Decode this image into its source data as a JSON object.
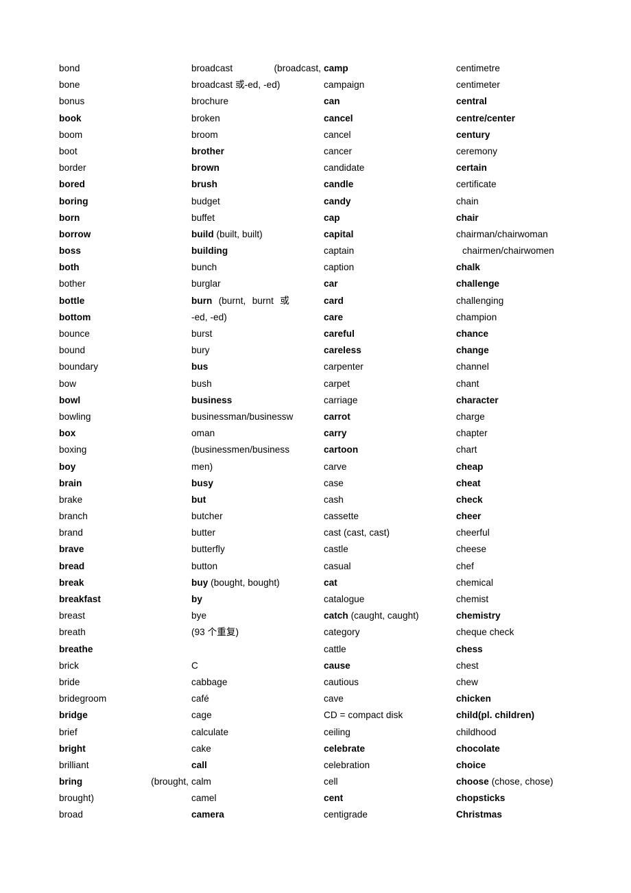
{
  "document": {
    "type": "vocabulary-word-list",
    "page_background": "#ffffff",
    "text_color": "#000000",
    "column_count": 4,
    "note_bold_meaning": "bold entries are required/core vocabulary words"
  },
  "columns": [
    {
      "name": "column-1",
      "entries": [
        {
          "text": "bond",
          "bold": false
        },
        {
          "text": "bone",
          "bold": false
        },
        {
          "text": "bonus",
          "bold": false
        },
        {
          "text": "book",
          "bold": true
        },
        {
          "text": "boom",
          "bold": false
        },
        {
          "text": "boot",
          "bold": false
        },
        {
          "text": "border",
          "bold": false
        },
        {
          "text": "bored",
          "bold": true
        },
        {
          "text": "boring",
          "bold": true
        },
        {
          "text": "born",
          "bold": true
        },
        {
          "text": "borrow",
          "bold": true
        },
        {
          "text": "boss",
          "bold": true
        },
        {
          "text": "both",
          "bold": true
        },
        {
          "text": "bother",
          "bold": false
        },
        {
          "text": "bottle",
          "bold": true
        },
        {
          "text": "bottom",
          "bold": true
        },
        {
          "text": "bounce",
          "bold": false
        },
        {
          "text": "bound",
          "bold": false
        },
        {
          "text": "boundary",
          "bold": false
        },
        {
          "text": "bow",
          "bold": false
        },
        {
          "text": "bowl",
          "bold": true
        },
        {
          "text": "bowling",
          "bold": false
        },
        {
          "text": "box",
          "bold": true
        },
        {
          "text": "boxing",
          "bold": false
        },
        {
          "text": "boy",
          "bold": true
        },
        {
          "text": "brain",
          "bold": true
        },
        {
          "text": "brake",
          "bold": false
        },
        {
          "text": "branch",
          "bold": false
        },
        {
          "text": "brand",
          "bold": false
        },
        {
          "text": "brave",
          "bold": true
        },
        {
          "text": "bread",
          "bold": true
        },
        {
          "text": "break",
          "bold": true
        },
        {
          "text": "breakfast",
          "bold": true
        },
        {
          "text": "breast",
          "bold": false
        },
        {
          "text": "breath",
          "bold": false
        },
        {
          "text": "breathe",
          "bold": true
        },
        {
          "text": "brick",
          "bold": false
        },
        {
          "text": "bride",
          "bold": false
        },
        {
          "text": "bridegroom",
          "bold": false
        },
        {
          "text": "bridge",
          "bold": true
        },
        {
          "text": "brief",
          "bold": false
        },
        {
          "text": "bright",
          "bold": true
        },
        {
          "text": "brilliant",
          "bold": false
        },
        {
          "head": "bring",
          "note": "(brought,",
          "bold": true,
          "layout": "spread"
        },
        {
          "text": "brought)",
          "bold": false
        },
        {
          "text": "broad",
          "bold": false
        }
      ]
    },
    {
      "name": "column-2",
      "entries": [
        {
          "head": "broadcast",
          "note": "(broadcast,",
          "bold": false,
          "layout": "spread"
        },
        {
          "text": "broadcast 或-ed, -ed)",
          "bold": false
        },
        {
          "text": "brochure",
          "bold": false
        },
        {
          "text": "broken",
          "bold": false
        },
        {
          "text": "broom",
          "bold": false
        },
        {
          "text": "brother",
          "bold": true
        },
        {
          "text": "brown",
          "bold": true
        },
        {
          "text": "brush",
          "bold": true
        },
        {
          "text": "budget",
          "bold": false
        },
        {
          "text": "buffet",
          "bold": false
        },
        {
          "head": "build",
          "note": " (built, built)",
          "layout": "mixed"
        },
        {
          "text": "building",
          "bold": true
        },
        {
          "text": "bunch",
          "bold": false
        },
        {
          "text": "burglar",
          "bold": false
        },
        {
          "head": "burn",
          "note": " (burnt, burnt 或",
          "layout": "mixed",
          "justify": "wide"
        },
        {
          "text": "-ed, -ed)",
          "bold": false
        },
        {
          "text": "burst",
          "bold": false
        },
        {
          "text": "bury",
          "bold": false
        },
        {
          "text": "bus",
          "bold": true
        },
        {
          "text": "bush",
          "bold": false
        },
        {
          "text": "business",
          "bold": true
        },
        {
          "text": "businessman/businessw",
          "bold": false
        },
        {
          "text": "oman",
          "bold": false
        },
        {
          "text": "(businessmen/business",
          "bold": false
        },
        {
          "text": "men)",
          "bold": false
        },
        {
          "text": "busy",
          "bold": true
        },
        {
          "text": "but",
          "bold": true
        },
        {
          "text": "butcher",
          "bold": false
        },
        {
          "text": "butter",
          "bold": false
        },
        {
          "text": "butterfly",
          "bold": false
        },
        {
          "text": "button",
          "bold": false
        },
        {
          "head": "buy",
          "note": " (bought, bought)",
          "layout": "mixed"
        },
        {
          "text": "by",
          "bold": true
        },
        {
          "text": "bye",
          "bold": false
        },
        {
          "text": "(93 个重复)",
          "bold": false
        },
        {
          "text": "",
          "bold": false,
          "blank": true
        },
        {
          "text": "C",
          "bold": false
        },
        {
          "text": "cabbage",
          "bold": false
        },
        {
          "text": "café",
          "bold": false
        },
        {
          "text": "cage",
          "bold": false
        },
        {
          "text": "calculate",
          "bold": false
        },
        {
          "text": "cake",
          "bold": false
        },
        {
          "text": "call",
          "bold": true
        },
        {
          "text": "calm",
          "bold": false
        },
        {
          "text": "camel",
          "bold": false
        },
        {
          "text": "camera",
          "bold": true
        }
      ]
    },
    {
      "name": "column-3",
      "entries": [
        {
          "text": "camp",
          "bold": true
        },
        {
          "text": "campaign",
          "bold": false
        },
        {
          "text": "can",
          "bold": true
        },
        {
          "text": "cancel",
          "bold": true
        },
        {
          "text": "cancel",
          "bold": false
        },
        {
          "text": "cancer",
          "bold": false
        },
        {
          "text": "candidate",
          "bold": false
        },
        {
          "text": "candle",
          "bold": true
        },
        {
          "text": "candy",
          "bold": true
        },
        {
          "text": "cap",
          "bold": true
        },
        {
          "text": "capital",
          "bold": true
        },
        {
          "text": "captain",
          "bold": false
        },
        {
          "text": "caption",
          "bold": false
        },
        {
          "text": "car",
          "bold": true
        },
        {
          "text": "card",
          "bold": true
        },
        {
          "text": "care",
          "bold": true
        },
        {
          "text": "careful",
          "bold": true
        },
        {
          "text": "careless",
          "bold": true
        },
        {
          "text": "carpenter",
          "bold": false
        },
        {
          "text": "carpet",
          "bold": false
        },
        {
          "text": "carriage",
          "bold": false
        },
        {
          "text": "carrot",
          "bold": true
        },
        {
          "text": "carry",
          "bold": true
        },
        {
          "text": "cartoon",
          "bold": true
        },
        {
          "text": "carve",
          "bold": false
        },
        {
          "text": "case",
          "bold": false
        },
        {
          "text": "cash",
          "bold": false
        },
        {
          "text": "cassette",
          "bold": false
        },
        {
          "text": "cast (cast, cast)",
          "bold": false
        },
        {
          "text": "castle",
          "bold": false
        },
        {
          "text": "casual",
          "bold": false
        },
        {
          "text": "cat",
          "bold": true
        },
        {
          "text": "catalogue",
          "bold": false
        },
        {
          "head": "catch",
          "note": " (caught, caught)",
          "layout": "mixed"
        },
        {
          "text": "category",
          "bold": false
        },
        {
          "text": "cattle",
          "bold": false
        },
        {
          "text": "cause",
          "bold": true
        },
        {
          "text": "cautious",
          "bold": false
        },
        {
          "text": "cave",
          "bold": false
        },
        {
          "text": "CD = compact disk",
          "bold": false
        },
        {
          "text": "ceiling",
          "bold": false
        },
        {
          "text": "celebrate",
          "bold": true
        },
        {
          "text": "celebration",
          "bold": false
        },
        {
          "text": "cell",
          "bold": false
        },
        {
          "text": "cent",
          "bold": true
        },
        {
          "text": "centigrade",
          "bold": false
        }
      ]
    },
    {
      "name": "column-4",
      "entries": [
        {
          "text": "centimetre",
          "bold": false
        },
        {
          "text": "centimeter",
          "bold": false
        },
        {
          "text": "central",
          "bold": true
        },
        {
          "text": "centre/center",
          "bold": true
        },
        {
          "text": "century",
          "bold": true
        },
        {
          "text": "ceremony",
          "bold": false
        },
        {
          "text": "certain",
          "bold": true
        },
        {
          "text": "certificate",
          "bold": false
        },
        {
          "text": "chain",
          "bold": false
        },
        {
          "text": "chair",
          "bold": true
        },
        {
          "text": "chairman/chairwoman",
          "bold": false
        },
        {
          "text": "chairmen/chairwomen",
          "bold": false,
          "indent": true
        },
        {
          "text": "chalk",
          "bold": true
        },
        {
          "text": "challenge",
          "bold": true
        },
        {
          "text": "challenging",
          "bold": false
        },
        {
          "text": "champion",
          "bold": false
        },
        {
          "text": "chance",
          "bold": true
        },
        {
          "text": "change",
          "bold": true
        },
        {
          "text": "channel",
          "bold": false
        },
        {
          "text": "chant",
          "bold": false
        },
        {
          "text": "character",
          "bold": true
        },
        {
          "text": "charge",
          "bold": false
        },
        {
          "text": "chapter",
          "bold": false
        },
        {
          "text": "chart",
          "bold": false
        },
        {
          "text": "cheap",
          "bold": true
        },
        {
          "text": "cheat",
          "bold": true
        },
        {
          "text": "check",
          "bold": true
        },
        {
          "text": "cheer",
          "bold": true
        },
        {
          "text": "cheerful",
          "bold": false
        },
        {
          "text": "cheese",
          "bold": false
        },
        {
          "text": "chef",
          "bold": false
        },
        {
          "text": "chemical",
          "bold": false
        },
        {
          "text": "chemist",
          "bold": false
        },
        {
          "text": "chemistry",
          "bold": true
        },
        {
          "text": "cheque check",
          "bold": false
        },
        {
          "text": "chess",
          "bold": true
        },
        {
          "text": "chest",
          "bold": false
        },
        {
          "text": "chew",
          "bold": false
        },
        {
          "text": "chicken",
          "bold": true
        },
        {
          "text": "child(pl. children)",
          "bold": true
        },
        {
          "text": "childhood",
          "bold": false
        },
        {
          "text": "chocolate",
          "bold": true
        },
        {
          "text": "choice",
          "bold": true
        },
        {
          "head": "choose",
          "note": " (chose, chose)",
          "layout": "mixed"
        },
        {
          "text": "chopsticks",
          "bold": true
        },
        {
          "text": "Christmas",
          "bold": true
        }
      ]
    }
  ]
}
